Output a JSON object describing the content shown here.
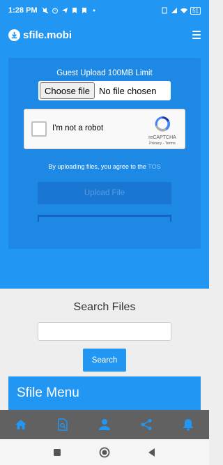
{
  "status_bar": {
    "time": "1:28 PM",
    "battery": "51"
  },
  "navbar": {
    "brand_name": "sfile.mobi"
  },
  "upload": {
    "title": "Guest Upload 100MB Limit",
    "choose_file_label": "Choose file",
    "no_file_text": "No file chosen",
    "captcha_label": "I'm not a robot",
    "captcha_brand": "reCAPTCHA",
    "captcha_links": "Privacy - Terms",
    "agree_text": "By uploading files, you agree to the",
    "tos_label": "TOS",
    "upload_button_label": "Upload File"
  },
  "search": {
    "title": "Search Files",
    "placeholder": "",
    "button_label": "Search"
  },
  "menu": {
    "title": "Sfile Menu"
  },
  "bottom_nav": {
    "icons": [
      "home-icon",
      "file-search-icon",
      "user-icon",
      "share-icon",
      "bell-icon"
    ]
  },
  "colors": {
    "primary": "#2196f3",
    "panel": "#1e88e5",
    "bottom_nav_bg": "#616161",
    "icon_blue": "#2196f3"
  }
}
